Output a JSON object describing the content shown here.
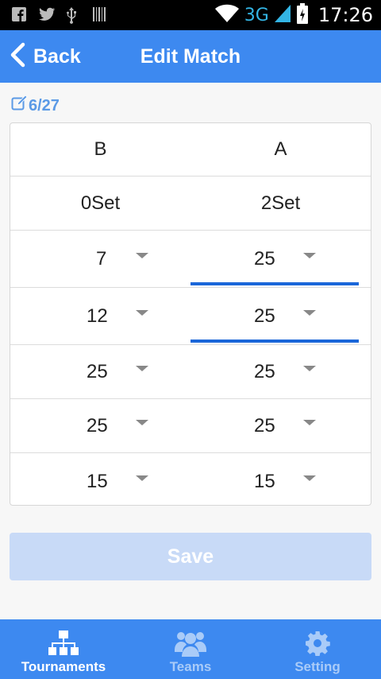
{
  "status_bar": {
    "network": "3G",
    "time": "17:26"
  },
  "header": {
    "back_label": "Back",
    "title": "Edit Match"
  },
  "match": {
    "date": "6/27",
    "team_left": "B",
    "team_right": "A",
    "sets_left": "0Set",
    "sets_right": "2Set",
    "scores": [
      {
        "left": "7",
        "right": "25"
      },
      {
        "left": "12",
        "right": "25"
      },
      {
        "left": "25",
        "right": "25"
      },
      {
        "left": "25",
        "right": "25"
      },
      {
        "left": "15",
        "right": "15"
      }
    ]
  },
  "save_label": "Save",
  "nav": [
    {
      "label": "Tournaments",
      "icon": "tournament-tree-icon",
      "active": true
    },
    {
      "label": "Teams",
      "icon": "teams-icon",
      "active": false
    },
    {
      "label": "Setting",
      "icon": "gear-icon",
      "active": false
    }
  ],
  "colors": {
    "primary": "#3d89f0",
    "accent_underline": "#1a66d9",
    "save_disabled": "#c8daf7",
    "date_text": "#5b9ae6"
  }
}
